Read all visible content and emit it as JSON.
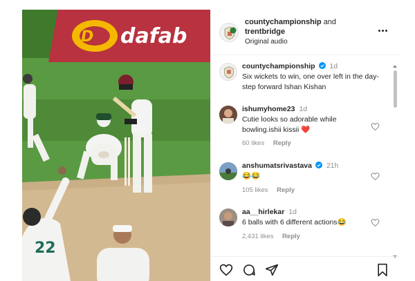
{
  "media": {
    "banner_text": "dafab",
    "player_number": "22"
  },
  "header": {
    "account_1": "countychampionship",
    "conjunction": "and",
    "account_2": "trentbridge",
    "audio": "Original audio"
  },
  "comments": [
    {
      "username": "countychampionship",
      "verified": true,
      "time": "1d",
      "text": "Six wickets to win, one over left in the day- step forward Ishan Kishan",
      "likes": "",
      "reply": ""
    },
    {
      "username": "ishumyhome23",
      "verified": false,
      "time": "1d",
      "text": "Cutie looks so adorable while bowling.ishii kissii",
      "emoji": "❤️",
      "likes": "60 likes",
      "reply": "Reply"
    },
    {
      "username": "anshumatsrivastava",
      "verified": true,
      "time": "21h",
      "text": "😂😂",
      "likes": "105 likes",
      "reply": "Reply"
    },
    {
      "username": "aa__hirlekar",
      "verified": false,
      "time": "1d",
      "text": "6 balls with 6 different actions😂",
      "likes": "2,431 likes",
      "reply": "Reply"
    }
  ],
  "colors": {
    "verified_blue": "#0095f6",
    "heart_red": "#ed4956",
    "muted_text": "#8e8e8e"
  },
  "icons": [
    "more-icon",
    "heart-icon",
    "comment-icon",
    "share-icon",
    "bookmark-icon",
    "verified-icon"
  ]
}
